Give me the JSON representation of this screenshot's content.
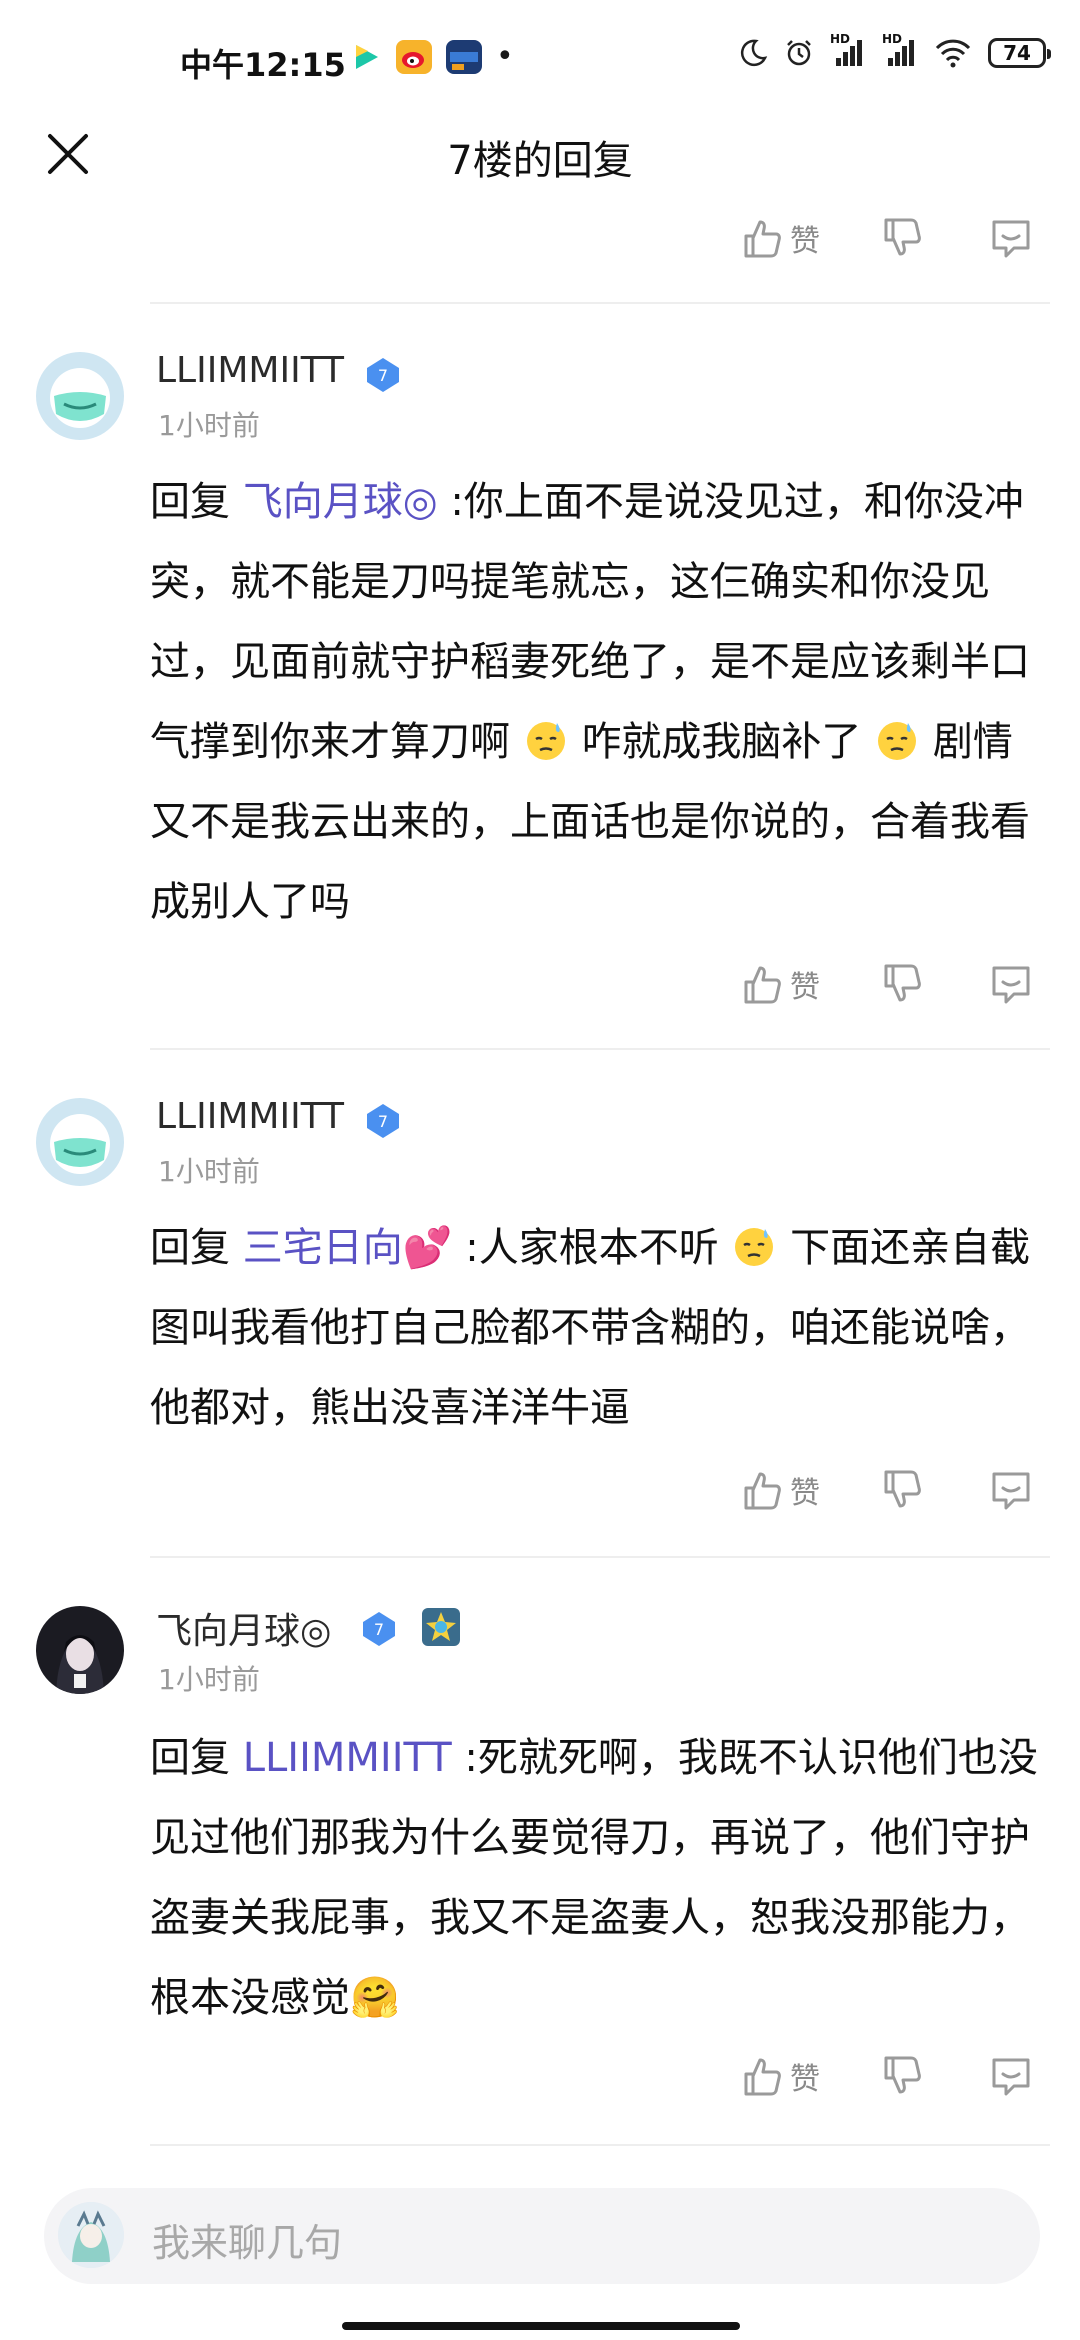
{
  "status_bar": {
    "time": "中午12:15",
    "battery": "74",
    "network_badges": [
      "HD",
      "HD"
    ]
  },
  "header": {
    "title": "7楼的回复"
  },
  "actions": {
    "like_label": "赞"
  },
  "comments": [
    {
      "username": "LLIIMMIITT",
      "level": "7",
      "time": "1小时前",
      "reply_prefix": "回复",
      "mention": "飞向月球◎",
      "text_parts": [
        ":你上面不是说没见过，和你没冲突，就不能是刀吗提笔就忘，这仨确实和你没见过，见面前就守护稻妻死绝了，是不是应该剩半口气撑到你来才算刀啊",
        "咋就成我脑补了",
        "剧情又不是我云出来的，上面话也是你说的，合着我看成别人了吗"
      ]
    },
    {
      "username": "LLIIMMIITT",
      "level": "7",
      "time": "1小时前",
      "reply_prefix": "回复",
      "mention": "三宅日向💕",
      "text_parts": [
        ":人家根本不听",
        "下面还亲自截图叫我看他打自己脸都不带含糊的，咱还能说啥，他都对，熊出没喜洋洋牛逼"
      ]
    },
    {
      "username": "飞向月球◎",
      "level": "7",
      "time": "1小时前",
      "reply_prefix": "回复",
      "mention": "LLIIMMIITT",
      "text_parts": [
        ":死就死啊，我既不认识他们也没见过他们那我为什么要觉得刀，再说了，他们守护盗妻关我屁事，我又不是盗妻人，恕我没那能力，根本没感觉🤗"
      ]
    }
  ],
  "input": {
    "placeholder": "我来聊几句"
  },
  "colors": {
    "mention": "#5a52c4",
    "badge": "#4a90f0"
  }
}
